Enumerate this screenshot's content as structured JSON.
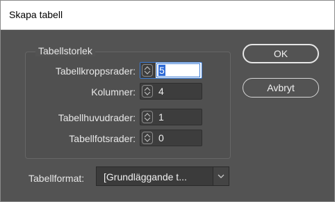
{
  "dialog": {
    "title": "Skapa tabell"
  },
  "group": {
    "label": "Tabellstorlek"
  },
  "fields": {
    "body_rows": {
      "label": "Tabellkroppsrader:",
      "value": "5"
    },
    "columns": {
      "label": "Kolumner:",
      "value": "4"
    },
    "header_rows": {
      "label": "Tabellhuvudrader:",
      "value": "1"
    },
    "footer_rows": {
      "label": "Tabellfotsrader:",
      "value": "0"
    }
  },
  "buttons": {
    "ok": "OK",
    "cancel": "Avbryt"
  },
  "format": {
    "label": "Tabellformat:",
    "value": "[Grundläggande t..."
  },
  "colors": {
    "background": "#535353",
    "focus": "#3a7bd5",
    "selection": "#2f6bd6"
  }
}
